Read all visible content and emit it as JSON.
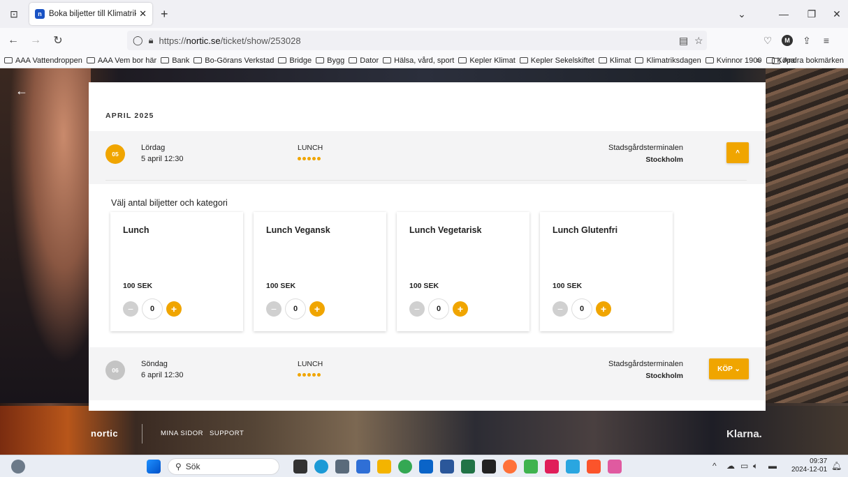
{
  "browser": {
    "tab_title": "Boka biljetter till Klimatriksdag",
    "tab_favicon": "n",
    "url_prefix": "https://",
    "url_host": "nortic.se",
    "url_path": "/ticket/show/253028",
    "bookmarks": [
      "AAA Vattendroppen",
      "AAA Vem bor här",
      "Bank",
      "Bo-Görans Verkstad",
      "Bridge",
      "Bygg",
      "Dator",
      "Hälsa, vård, sport",
      "Kepler Klimat",
      "Kepler Sekelskiftet",
      "Klimat",
      "Klimatriksdagen",
      "Kvinnor 1900",
      "Köpa"
    ],
    "bookmarks_other": "Andra bokmärken",
    "avatar_letter": "M"
  },
  "colors": {
    "accent": "#f0a500",
    "inactive_badge": "#c4c4c4"
  },
  "booking": {
    "month": "APRIL 2025",
    "events": [
      {
        "day_num": "05",
        "day_name": "Lördag",
        "date": "5 april 12:30",
        "category": "LUNCH",
        "venue": "Stadsgårdsterminalen",
        "city": "Stockholm",
        "button": "^",
        "expanded": true
      },
      {
        "day_num": "06",
        "day_name": "Söndag",
        "date": "6 april 12:30",
        "category": "LUNCH",
        "venue": "Stadsgårdsterminalen",
        "city": "Stockholm",
        "button": "KÖP ⌄",
        "expanded": false
      }
    ],
    "choose_label": "Välj antal biljetter och kategori",
    "tickets": [
      {
        "name": "Lunch",
        "price": "100 SEK",
        "qty": "0"
      },
      {
        "name": "Lunch Vegansk",
        "price": "100 SEK",
        "qty": "0"
      },
      {
        "name": "Lunch Vegetarisk",
        "price": "100 SEK",
        "qty": "0"
      },
      {
        "name": "Lunch Glutenfri",
        "price": "100 SEK",
        "qty": "0"
      }
    ]
  },
  "footer": {
    "brand": "nortic",
    "links": [
      "MINA SIDOR",
      "SUPPORT"
    ],
    "payment": "Klarna."
  },
  "taskbar": {
    "search_placeholder": "Sök",
    "time": "09:37",
    "date": "2024-12-01"
  }
}
